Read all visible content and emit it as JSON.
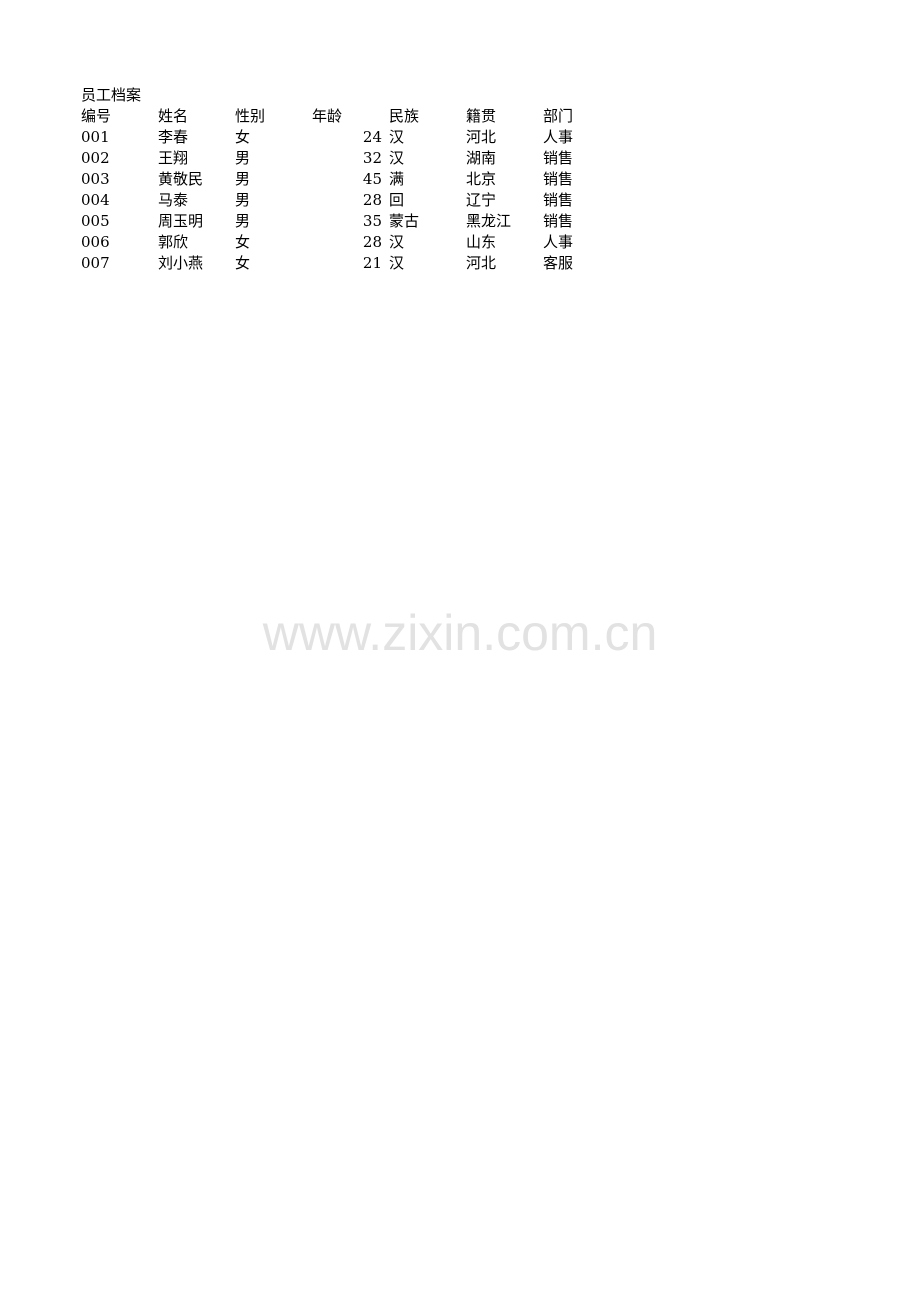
{
  "document": {
    "title": "员工档案",
    "columns": [
      "编号",
      "姓名",
      "性别",
      "年龄",
      "民族",
      "籍贯",
      "部门"
    ],
    "rows": [
      {
        "id": "001",
        "name": "李春",
        "sex": "女",
        "age": "24",
        "ethnicity": "汉",
        "hometown": "河北",
        "department": "人事"
      },
      {
        "id": "002",
        "name": "王翔",
        "sex": "男",
        "age": "32",
        "ethnicity": "汉",
        "hometown": "湖南",
        "department": "销售"
      },
      {
        "id": "003",
        "name": "黄敬民",
        "sex": "男",
        "age": "45",
        "ethnicity": "满",
        "hometown": "北京",
        "department": "销售"
      },
      {
        "id": "004",
        "name": "马泰",
        "sex": "男",
        "age": "28",
        "ethnicity": "回",
        "hometown": "辽宁",
        "department": "销售"
      },
      {
        "id": "005",
        "name": "周玉明",
        "sex": "男",
        "age": "35",
        "ethnicity": "蒙古",
        "hometown": "黑龙江",
        "department": "销售"
      },
      {
        "id": "006",
        "name": "郭欣",
        "sex": "女",
        "age": "28",
        "ethnicity": "汉",
        "hometown": "山东",
        "department": "人事"
      },
      {
        "id": "007",
        "name": "刘小燕",
        "sex": "女",
        "age": "21",
        "ethnicity": "汉",
        "hometown": "河北",
        "department": "客服"
      }
    ]
  },
  "watermark": {
    "text": "www.zixin.com.cn",
    "color": "#e2e2e2"
  }
}
